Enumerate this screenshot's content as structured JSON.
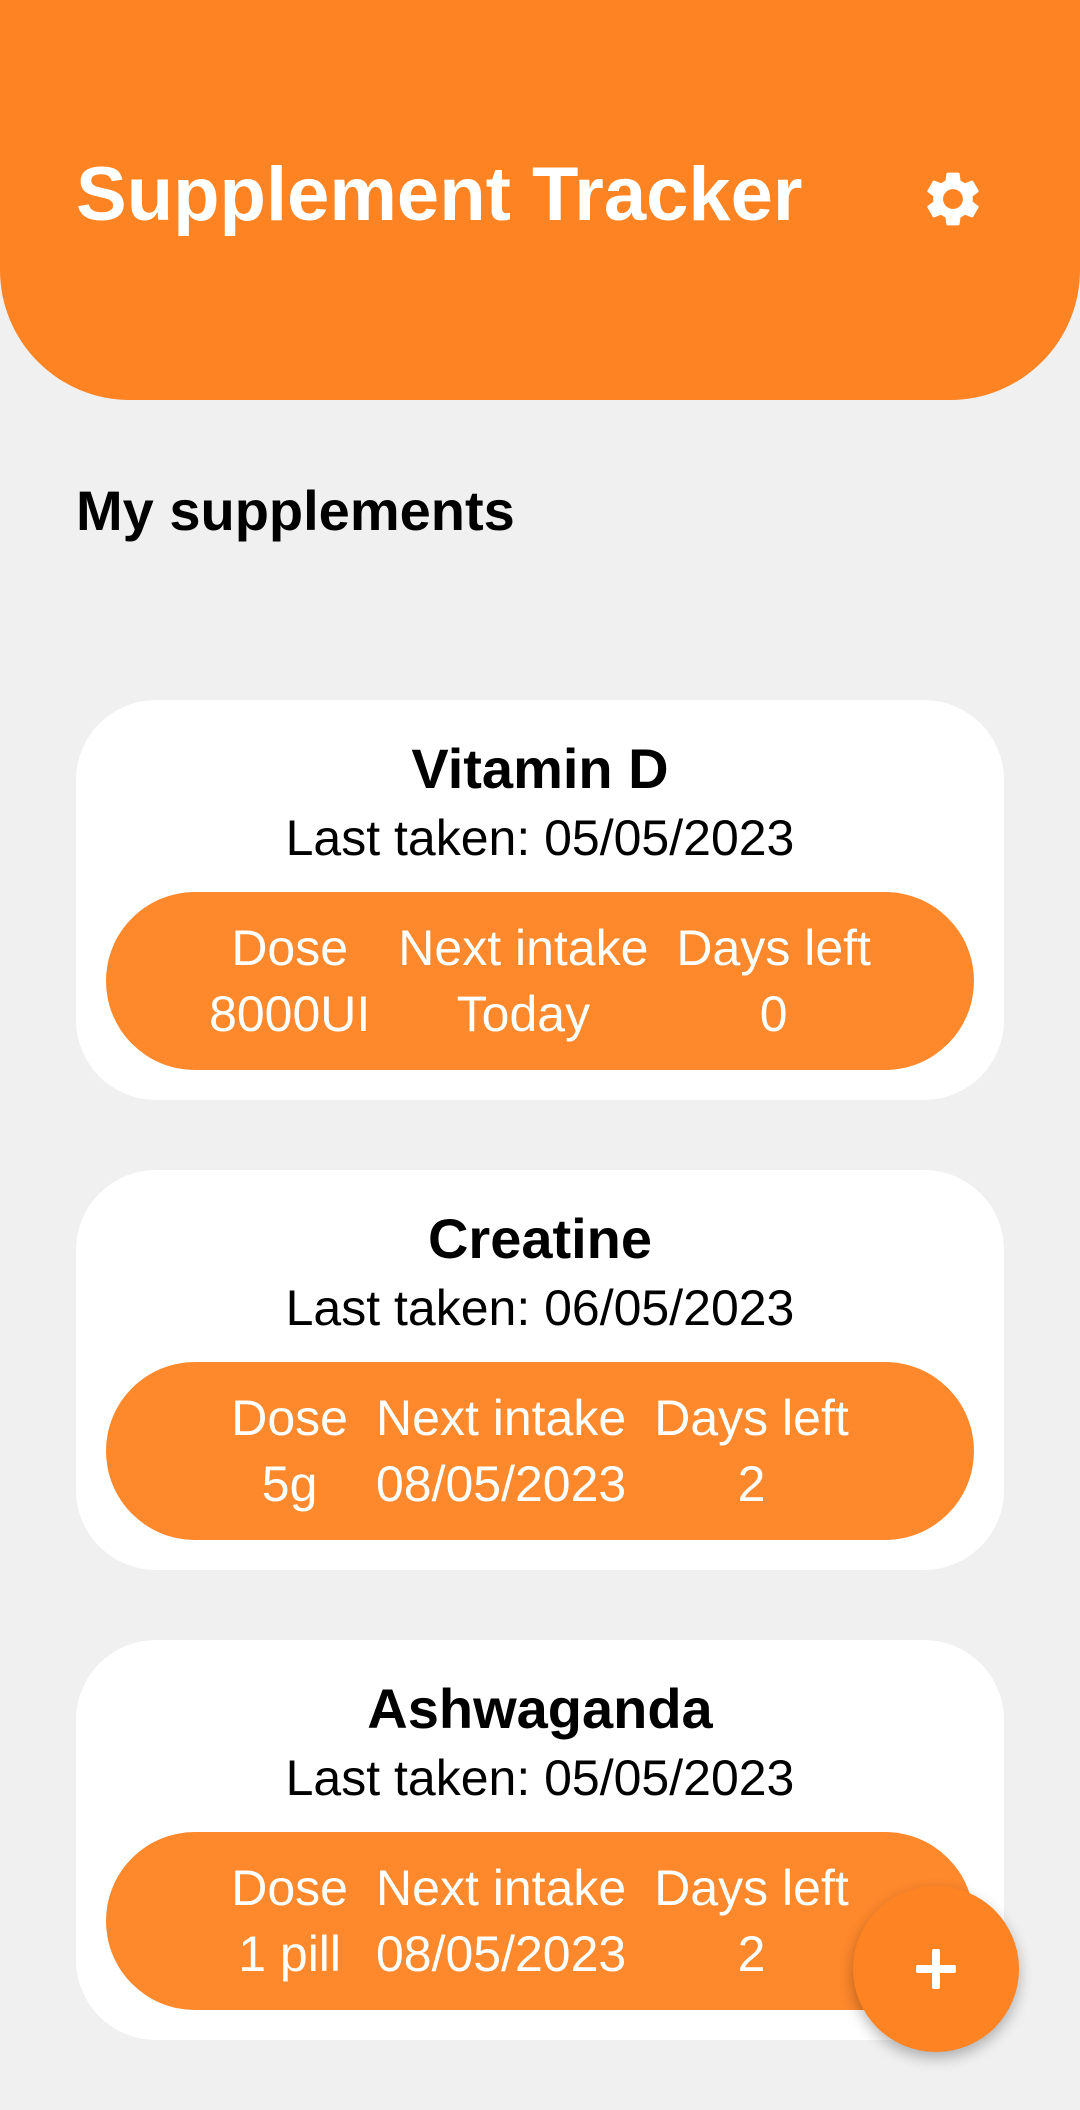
{
  "header": {
    "title": "Supplement Tracker",
    "settings_icon": "gear-icon"
  },
  "section": {
    "title": "My supplements"
  },
  "supplements": [
    {
      "name": "Vitamin D",
      "last_taken": "Last taken: 05/05/2023",
      "dose_label": "Dose",
      "dose": "8000UI",
      "next_label": "Next intake",
      "next_intake": "Today",
      "days_label": "Days left",
      "days_left": "0"
    },
    {
      "name": "Creatine",
      "last_taken": "Last taken: 06/05/2023",
      "dose_label": "Dose",
      "dose": "5g",
      "next_label": "Next intake",
      "next_intake": "08/05/2023",
      "days_label": "Days left",
      "days_left": "2"
    },
    {
      "name": "Ashwaganda",
      "last_taken": "Last taken: 05/05/2023",
      "dose_label": "Dose",
      "dose": "1 pill",
      "next_label": "Next intake",
      "next_intake": "08/05/2023",
      "days_label": "Days left",
      "days_left": "2"
    }
  ],
  "fab": {
    "icon": "plus-icon"
  },
  "colors": {
    "accent": "#fe8322",
    "background": "#f0f0f0",
    "card": "#ffffff"
  }
}
